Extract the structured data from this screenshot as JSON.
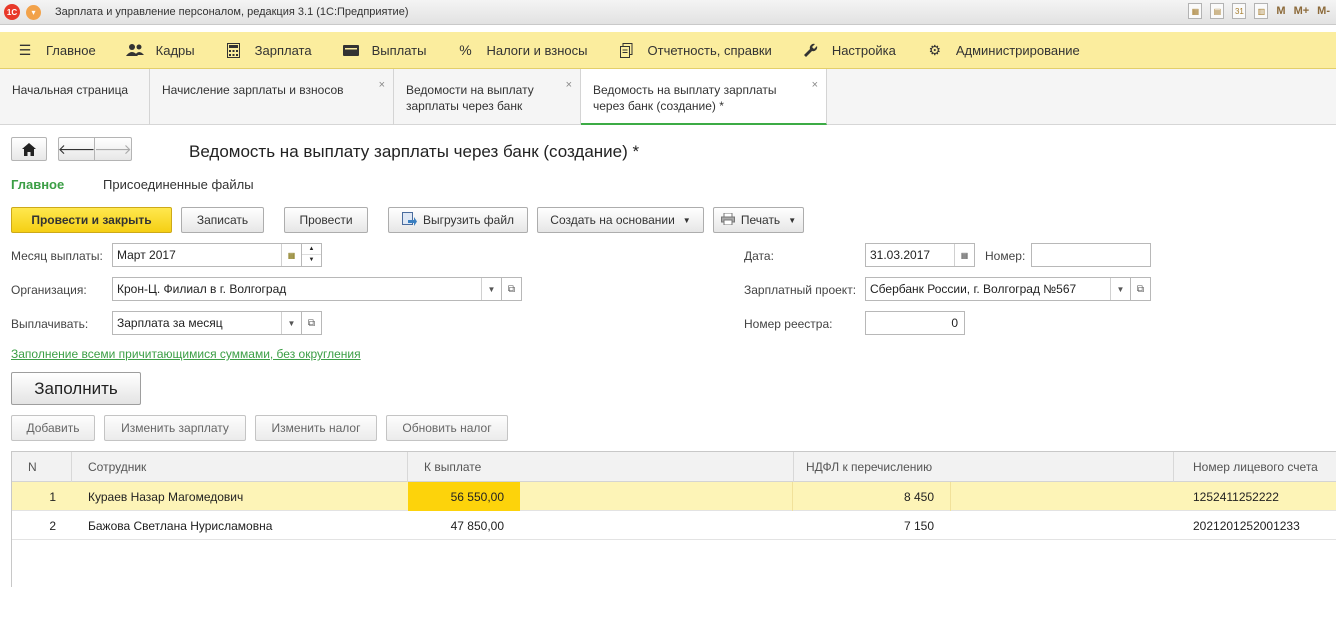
{
  "window": {
    "title": "Зарплата и управление персоналом, редакция 3.1  (1С:Предприятие)",
    "right_labels": [
      "M",
      "M+",
      "M-"
    ]
  },
  "sections": [
    {
      "label": "Главное",
      "icon": "hamburger-icon"
    },
    {
      "label": "Кадры",
      "icon": "people-icon"
    },
    {
      "label": "Зарплата",
      "icon": "calculator-icon"
    },
    {
      "label": "Выплаты",
      "icon": "wallet-icon"
    },
    {
      "label": "Налоги и взносы",
      "icon": "percent-icon"
    },
    {
      "label": "Отчетность, справки",
      "icon": "documents-icon"
    },
    {
      "label": "Настройка",
      "icon": "wrench-icon"
    },
    {
      "label": "Администрирование",
      "icon": "gear-icon"
    }
  ],
  "tabs": [
    {
      "label": "Начальная страница"
    },
    {
      "label": "Начисление зарплаты и взносов"
    },
    {
      "label_line1": "Ведомости на выплату",
      "label_line2": "зарплаты через банк"
    },
    {
      "label_line1": "Ведомость на выплату зарплаты",
      "label_line2": "через банк (создание) *"
    }
  ],
  "form": {
    "title": "Ведомость на выплату зарплаты через банк (создание) *",
    "tab_main": "Главное",
    "tab_files": "Присоединенные файлы",
    "toolbar": {
      "post_close": "Провести и закрыть",
      "save": "Записать",
      "post": "Провести",
      "upload": "Выгрузить файл",
      "create_based": "Создать на основании",
      "print": "Печать"
    },
    "fields": {
      "month_label": "Месяц выплаты:",
      "month_value": "Март 2017",
      "org_label": "Организация:",
      "org_value": "Крон-Ц. Филиал в г. Волгоград",
      "pay_label": "Выплачивать:",
      "pay_value": "Зарплата за месяц",
      "date_label": "Дата:",
      "date_value": "31.03.2017",
      "number_label": "Номер:",
      "number_value": "",
      "project_label": "Зарплатный проект:",
      "project_value": "Сбербанк России, г. Волгоград №567",
      "registry_label": "Номер реестра:",
      "registry_value": "0"
    },
    "fill_link": "Заполнение всеми причитающимися суммами, без округления",
    "fill_button": "Заполнить",
    "table_toolbar": {
      "add": "Добавить",
      "change_salary": "Изменить зарплату",
      "change_tax": "Изменить налог",
      "refresh_tax": "Обновить налог"
    },
    "table": {
      "headers": [
        "N",
        "Сотрудник",
        "К выплате",
        "НДФЛ к перечислению",
        "Номер лицевого счета"
      ],
      "rows": [
        [
          "1",
          "Кураев Назар Магомедович",
          "56 550,00",
          "8 450",
          "1252411252222"
        ],
        [
          "2",
          "Бажова Светлана Нурисламовна",
          "47 850,00",
          "7 150",
          "2021201252001233"
        ]
      ]
    }
  },
  "colors": {
    "sections_bg": "#fbed9e",
    "accent_green": "#3b9e45",
    "primary_button": "#f5cf14",
    "selected_row": "#fdf4b7",
    "selected_cell": "#fdd30b"
  }
}
